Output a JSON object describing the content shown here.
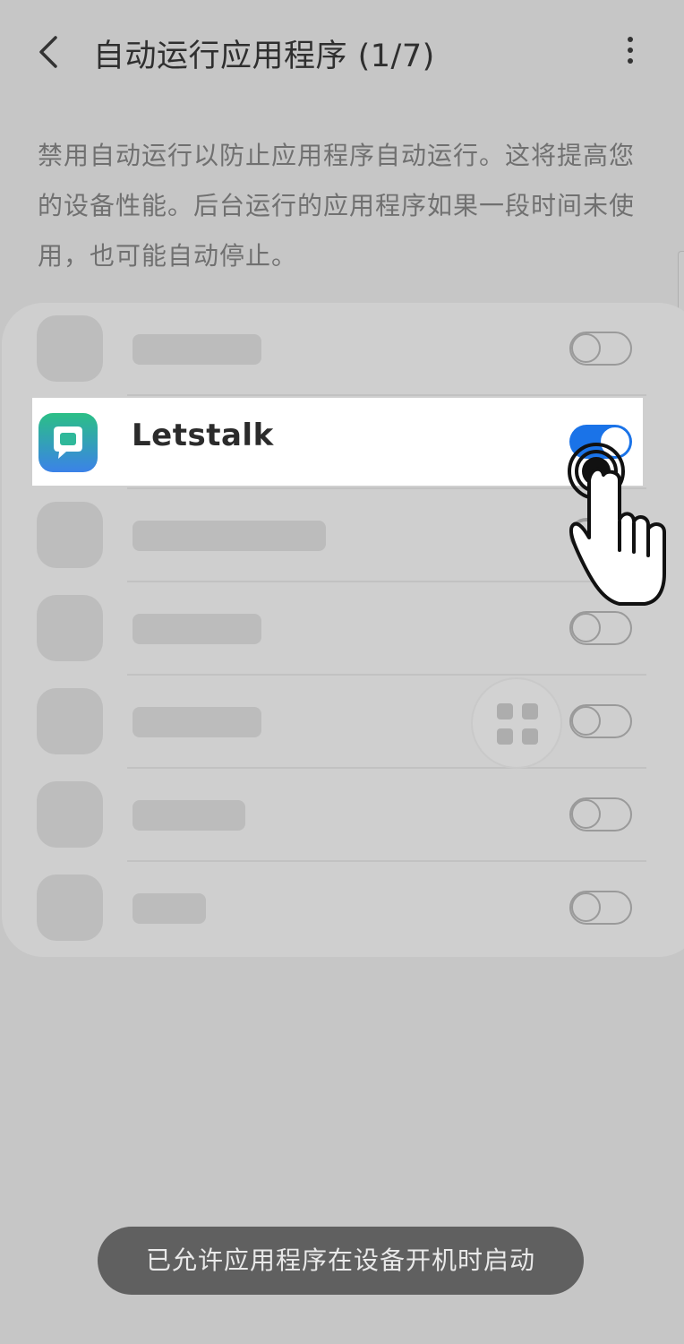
{
  "header": {
    "title": "自动运行应用程序 (1/7)",
    "back_icon": "chevron-left-icon",
    "more_icon": "more-vertical-icon"
  },
  "description": "禁用自动运行以防止应用程序自动运行。这将提高您的设备性能。后台运行的应用程序如果一段时间未使用，也可能自动停止。",
  "apps": [
    {
      "name": "",
      "enabled": false,
      "placeholder": true
    },
    {
      "name": "Letstalk",
      "enabled": true,
      "icon": "letstalk-chat-icon",
      "highlighted": true
    },
    {
      "name": "",
      "enabled": false,
      "placeholder": true
    },
    {
      "name": "",
      "enabled": false,
      "placeholder": true
    },
    {
      "name": "",
      "enabled": false,
      "placeholder": true
    },
    {
      "name": "",
      "enabled": false,
      "placeholder": true
    },
    {
      "name": "",
      "enabled": false,
      "placeholder": true
    }
  ],
  "toast": "已允许应用程序在设备开机时启动",
  "colors": {
    "accent": "#1a73e8",
    "background": "#c6c6c6",
    "toast_bg": "#606060",
    "app_icon_green": "#2bbf86",
    "app_icon_blue": "#3b82e8"
  }
}
